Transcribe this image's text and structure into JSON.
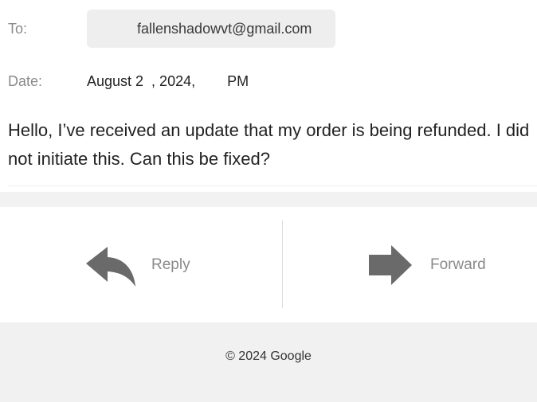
{
  "header": {
    "to_label": "To:",
    "to_value": "fallenshadowvt@gmail.com",
    "date_label": "Date:",
    "date_value": "August 2  , 2024,        PM"
  },
  "message": {
    "body": "Hello, I’ve received an update that my order is being refunded. I did not initiate this. Can this be fixed?"
  },
  "actions": {
    "reply_label": "Reply",
    "forward_label": "Forward",
    "reply_icon": "reply-arrow-icon",
    "forward_icon": "forward-arrow-icon",
    "icon_color": "#6a6a6a"
  },
  "footer": {
    "copyright": "© 2024 Google"
  }
}
